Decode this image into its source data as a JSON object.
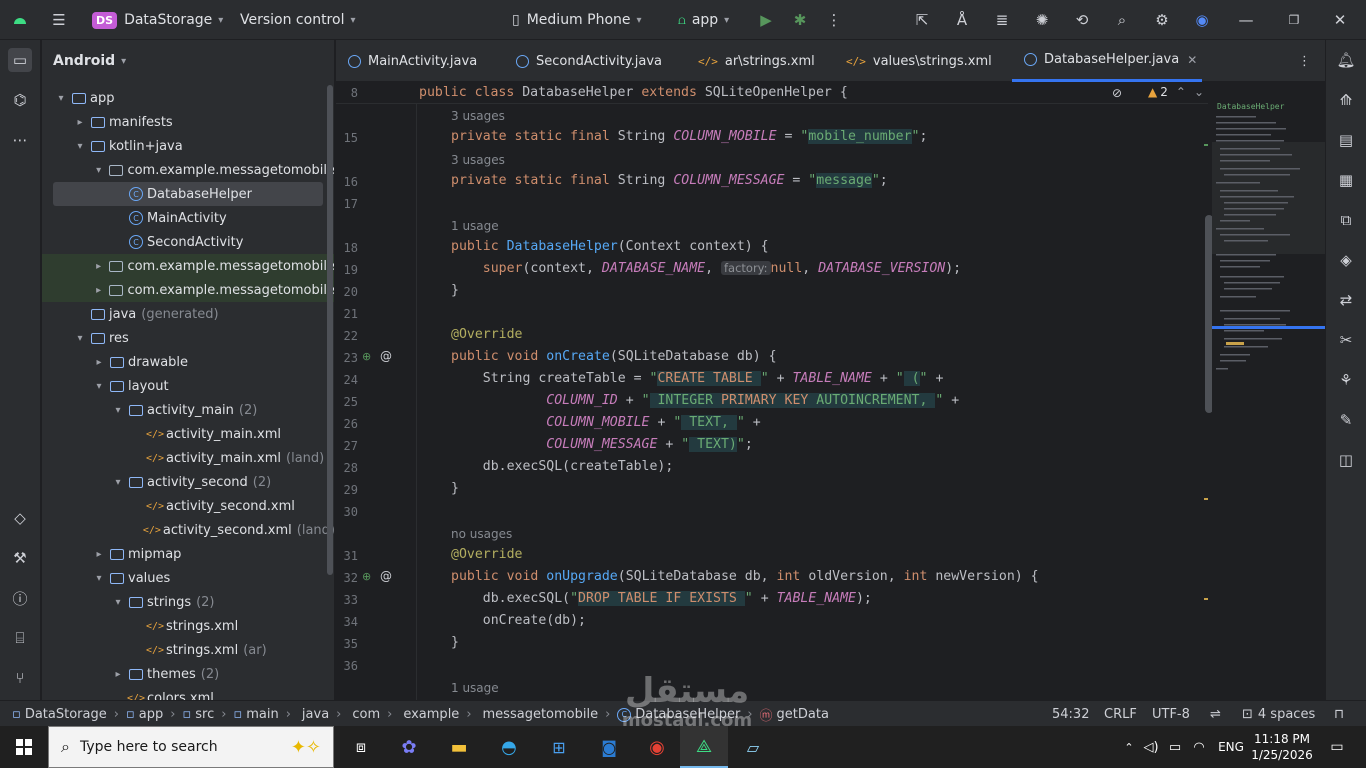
{
  "topbar": {
    "project_badge": "DS",
    "project": "DataStorage",
    "vcs": "Version control",
    "device": "Medium Phone",
    "run_config": "app"
  },
  "project_panel": {
    "view": "Android",
    "rows": [
      {
        "label": "app",
        "extra": "",
        "depth": 0,
        "arrow": "▾",
        "icon": "folder"
      },
      {
        "label": "manifests",
        "extra": "",
        "depth": 1,
        "arrow": "▸",
        "icon": "folder"
      },
      {
        "label": "kotlin+java",
        "extra": "",
        "depth": 1,
        "arrow": "▾",
        "icon": "folder"
      },
      {
        "label": "com.example.messagetomobile",
        "extra": "",
        "depth": 2,
        "arrow": "▾",
        "icon": "package"
      },
      {
        "label": "DatabaseHelper",
        "extra": "",
        "depth": 3,
        "arrow": "",
        "icon": "class"
      },
      {
        "label": "MainActivity",
        "extra": "",
        "depth": 3,
        "arrow": "",
        "icon": "class"
      },
      {
        "label": "SecondActivity",
        "extra": "",
        "depth": 3,
        "arrow": "",
        "icon": "class"
      },
      {
        "label": "com.example.messagetomobile",
        "extra": "",
        "depth": 2,
        "arrow": "▸",
        "icon": "package"
      },
      {
        "label": "com.example.messagetomobile",
        "extra": "",
        "depth": 2,
        "arrow": "▸",
        "icon": "package"
      },
      {
        "label": "java",
        "extra": "(generated)",
        "depth": 1,
        "arrow": "",
        "icon": "folder"
      },
      {
        "label": "res",
        "extra": "",
        "depth": 1,
        "arrow": "▾",
        "icon": "folder"
      },
      {
        "label": "drawable",
        "extra": "",
        "depth": 2,
        "arrow": "▸",
        "icon": "folder"
      },
      {
        "label": "layout",
        "extra": "",
        "depth": 2,
        "arrow": "▾",
        "icon": "folder"
      },
      {
        "label": "activity_main",
        "extra": "(2)",
        "depth": 3,
        "arrow": "▾",
        "icon": "folder"
      },
      {
        "label": "activity_main.xml",
        "extra": "",
        "depth": 4,
        "arrow": "",
        "icon": "xml"
      },
      {
        "label": "activity_main.xml",
        "extra": "(land)",
        "depth": 4,
        "arrow": "",
        "icon": "xml"
      },
      {
        "label": "activity_second",
        "extra": "(2)",
        "depth": 3,
        "arrow": "▾",
        "icon": "folder"
      },
      {
        "label": "activity_second.xml",
        "extra": "",
        "depth": 4,
        "arrow": "",
        "icon": "xml"
      },
      {
        "label": "activity_second.xml",
        "extra": "(land)",
        "depth": 4,
        "arrow": "",
        "icon": "xml"
      },
      {
        "label": "mipmap",
        "extra": "",
        "depth": 2,
        "arrow": "▸",
        "icon": "folder"
      },
      {
        "label": "values",
        "extra": "",
        "depth": 2,
        "arrow": "▾",
        "icon": "folder"
      },
      {
        "label": "strings",
        "extra": "(2)",
        "depth": 3,
        "arrow": "▾",
        "icon": "folder"
      },
      {
        "label": "strings.xml",
        "extra": "",
        "depth": 4,
        "arrow": "",
        "icon": "xml"
      },
      {
        "label": "strings.xml",
        "extra": "(ar)",
        "depth": 4,
        "arrow": "",
        "icon": "xml"
      },
      {
        "label": "themes",
        "extra": "(2)",
        "depth": 3,
        "arrow": "▸",
        "icon": "folder"
      },
      {
        "label": "colors.xml",
        "extra": "",
        "depth": 3,
        "arrow": "",
        "icon": "xml"
      }
    ]
  },
  "tabs": [
    {
      "label": "MainActivity.java",
      "type": "class",
      "active": false
    },
    {
      "label": "SecondActivity.java",
      "type": "class",
      "active": false
    },
    {
      "label": "ar\\strings.xml",
      "type": "xml",
      "active": false
    },
    {
      "label": "values\\strings.xml",
      "type": "xml",
      "active": false
    },
    {
      "label": "DatabaseHelper.java",
      "type": "class",
      "active": true
    }
  ],
  "editor": {
    "sticky_line": "8",
    "sticky_code": "public class DatabaseHelper extends SQLiteOpenHelper {",
    "warnings": "2",
    "usage_hints": [
      "3 usages",
      "3 usages",
      "1 usage",
      "no usages",
      "1 usage"
    ],
    "inlay_factory": "factory:",
    "line_numbers": [
      "15",
      "16",
      "17",
      "18",
      "19",
      "20",
      "21",
      "22",
      "23",
      "24",
      "25",
      "26",
      "27",
      "28",
      "29",
      "30",
      "31",
      "32",
      "33",
      "34",
      "35",
      "36"
    ],
    "minimap_label": "DatabaseHelper"
  },
  "statusbar": {
    "crumbs": [
      "DataStorage",
      "app",
      "src",
      "main",
      "java",
      "com",
      "example",
      "messagetomobile",
      "DatabaseHelper",
      "getData"
    ],
    "position": "54:32",
    "line_sep": "CRLF",
    "encoding": "UTF-8",
    "indent": "4 spaces"
  },
  "taskbar": {
    "search_placeholder": "Type here to search",
    "lang": "ENG",
    "time": "11:18 PM",
    "date": "1/25/2026"
  },
  "watermark": "مستقل mostaql.com"
}
